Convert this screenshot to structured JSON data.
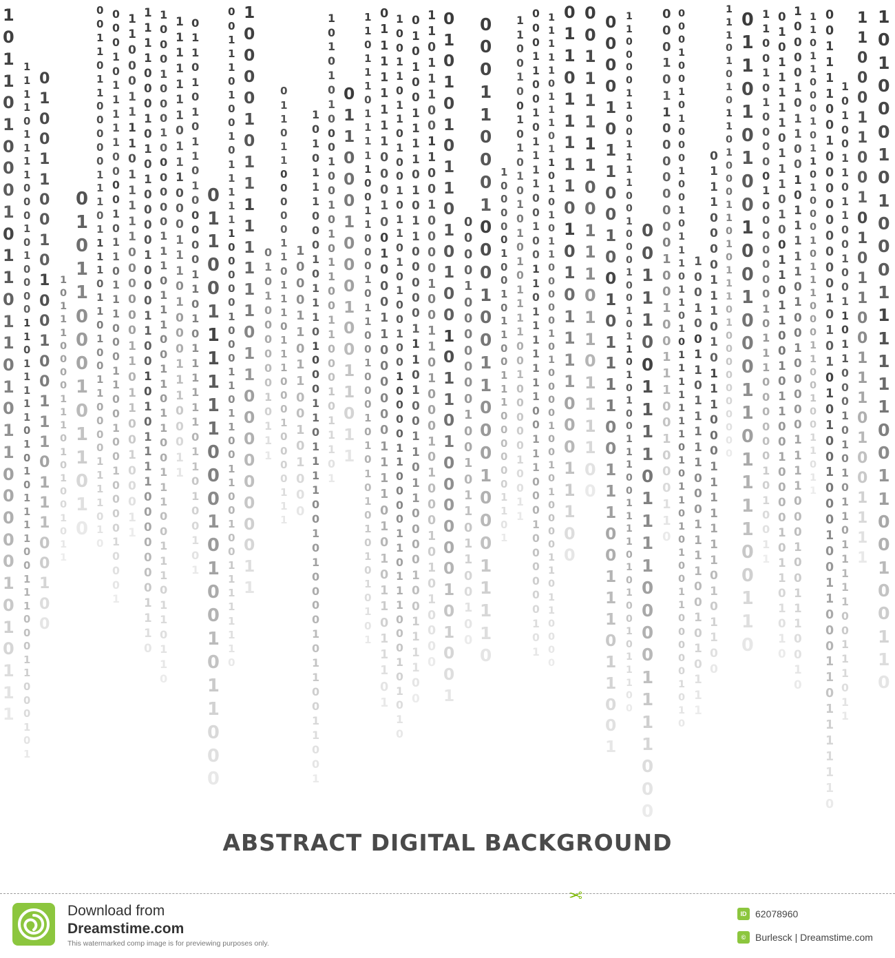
{
  "headline": "ABSTRACT DIGITAL BACKGROUND",
  "binary_symbols": [
    "0",
    "1"
  ],
  "colors": {
    "digit_dark": "#3a3a3a",
    "digit_light": "#ececec",
    "text": "#4a4a4a",
    "brand_green": "#8cc63e"
  },
  "watermark": {
    "download_text": "Download from",
    "brand_text": "Dreamstime.com",
    "notice_text": "This watermarked comp image is for previewing purposes only.",
    "id_badge": "ID",
    "image_id": "62078960",
    "author_badge": "©",
    "author_text": "Burlesck | Dreamstime.com",
    "logo_icon": "dreamstime-spiral-icon",
    "cut_icon": "scissors-icon"
  }
}
